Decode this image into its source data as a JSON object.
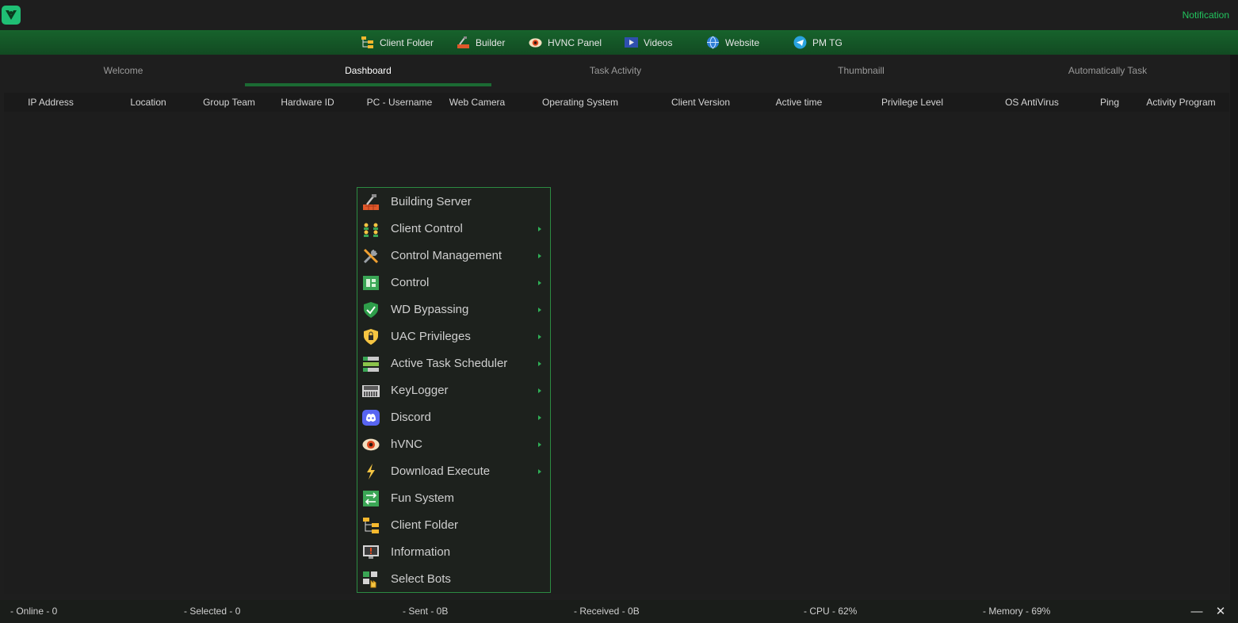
{
  "header": {
    "notification": "Notification"
  },
  "toolbar": [
    {
      "label": "Client Folder",
      "icon": "folder-tree-icon"
    },
    {
      "label": "Builder",
      "icon": "builder-icon"
    },
    {
      "label": "HVNC Panel",
      "icon": "eye-icon"
    },
    {
      "label": "Videos",
      "icon": "video-icon"
    },
    {
      "label": "Website",
      "icon": "globe-icon"
    },
    {
      "label": "PM TG",
      "icon": "telegram-icon"
    }
  ],
  "tabs": [
    {
      "label": "Welcome"
    },
    {
      "label": "Dashboard",
      "active": true
    },
    {
      "label": "Task Activity"
    },
    {
      "label": "Thumbnaill"
    },
    {
      "label": "Automatically Task"
    }
  ],
  "columns": [
    "IP Address",
    "Location",
    "Group Team",
    "Hardware ID",
    "PC - Username",
    "Web Camera",
    "Operating System",
    "Client Version",
    "Active time",
    "Privilege Level",
    "OS AntiVirus",
    "Ping",
    "Activity Program"
  ],
  "context_menu": [
    {
      "label": "Building Server",
      "icon": "builder-icon",
      "submenu": false
    },
    {
      "label": "Client Control",
      "icon": "users-icon",
      "submenu": true
    },
    {
      "label": "Control Management",
      "icon": "tools-icon",
      "submenu": true
    },
    {
      "label": "Control",
      "icon": "chip-icon",
      "submenu": true
    },
    {
      "label": "WD Bypassing",
      "icon": "shield-check-icon",
      "submenu": true
    },
    {
      "label": "UAC Privileges",
      "icon": "shield-lock-icon",
      "submenu": true
    },
    {
      "label": "Active Task Scheduler",
      "icon": "task-list-icon",
      "submenu": true
    },
    {
      "label": "KeyLogger",
      "icon": "keyboard-icon",
      "submenu": true
    },
    {
      "label": "Discord",
      "icon": "discord-icon",
      "submenu": true
    },
    {
      "label": "hVNC",
      "icon": "eye-icon",
      "submenu": true
    },
    {
      "label": "Download Execute",
      "icon": "lightning-icon",
      "submenu": true
    },
    {
      "label": "Fun System",
      "icon": "fun-system-icon",
      "submenu": false
    },
    {
      "label": "Client Folder",
      "icon": "folder-tree-icon",
      "submenu": false
    },
    {
      "label": "Information",
      "icon": "info-monitor-icon",
      "submenu": false
    },
    {
      "label": "Select Bots",
      "icon": "select-bots-icon",
      "submenu": false
    }
  ],
  "status": {
    "online": "- Online - 0",
    "selected": "- Selected - 0",
    "sent": "- Sent - 0B",
    "received": "- Received -  0B",
    "cpu": "- CPU - 62%",
    "memory": "- Memory - 69%"
  },
  "window_controls": {
    "minimize": "—",
    "close": "✕"
  },
  "colors": {
    "accent": "#1b6b33",
    "notification": "#22c55e",
    "menu_border": "#2c8a42"
  }
}
